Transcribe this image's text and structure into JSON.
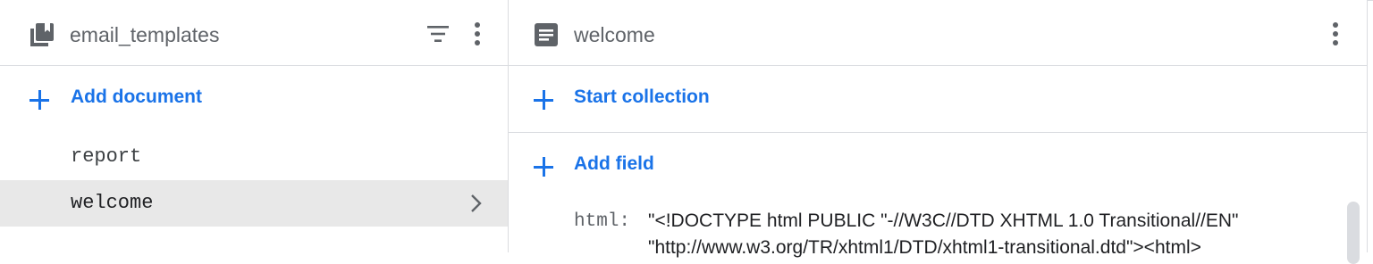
{
  "left_panel": {
    "title": "email_templates",
    "header_icon": "collection-icon",
    "filter_icon": "filter-icon",
    "more_icon": "more-vert-icon",
    "add_label": "Add document",
    "documents": [
      {
        "id": "report",
        "selected": false
      },
      {
        "id": "welcome",
        "selected": true
      }
    ]
  },
  "right_panel": {
    "title": "welcome",
    "header_icon": "document-icon",
    "more_icon": "more-vert-icon",
    "start_collection_label": "Start collection",
    "add_field_label": "Add field",
    "fields": [
      {
        "key": "html:",
        "value_line1": "\"<!DOCTYPE html PUBLIC \"-//W3C//DTD XHTML 1.0 Transitional//EN\"",
        "value_line2": "\"http://www.w3.org/TR/xhtml1/DTD/xhtml1-transitional.dtd\"><html>"
      }
    ]
  },
  "colors": {
    "accent": "#1a73e8",
    "selected_bg": "#e8e8e8",
    "divider": "#dadce0"
  }
}
